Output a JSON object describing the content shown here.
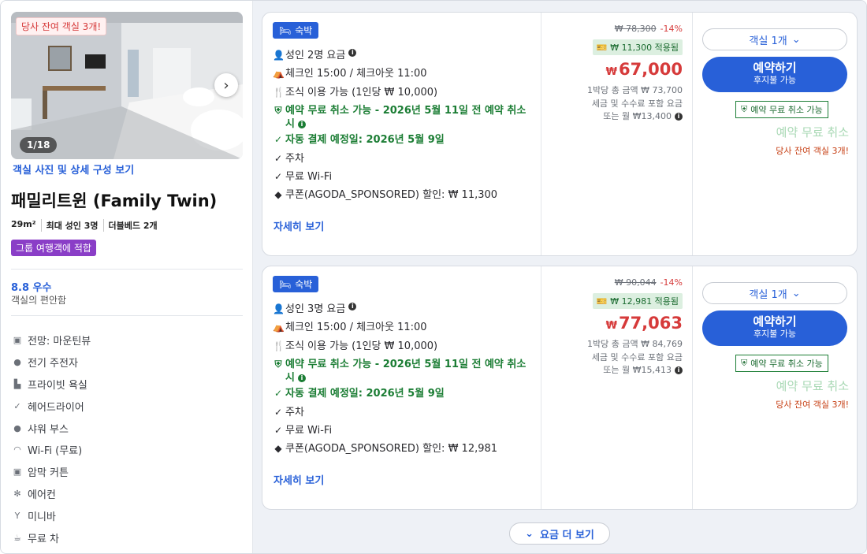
{
  "room": {
    "photo_badge": "당사 잔여 객실 3개!",
    "photo_counter": "1/18",
    "photo_link": "객실 사진 및 상세 구성 보기",
    "name": "패밀리트윈 (Family Twin)",
    "specs": [
      "29m²",
      "최대 성인 3명",
      "더블베드 2개"
    ],
    "group_badge": "그룹 여행객에 적합",
    "score": "8.8 우수",
    "score_sub": "객실의 편안함",
    "amenities": [
      {
        "icon": "mountain-view-icon",
        "label": "전망: 마운틴뷰"
      },
      {
        "icon": "ev-charger-icon",
        "label": "전기 주전자"
      },
      {
        "icon": "bathtub-icon",
        "label": "프라이빗 욕실"
      },
      {
        "icon": "check-icon",
        "label": "헤어드라이어"
      },
      {
        "icon": "shower-icon",
        "label": "샤워 부스"
      },
      {
        "icon": "wifi-icon",
        "label": "Wi-Fi (무료)"
      },
      {
        "icon": "blackout-curtain-icon",
        "label": "암막 커튼"
      },
      {
        "icon": "air-conditioner-icon",
        "label": "에어컨"
      },
      {
        "icon": "minibar-icon",
        "label": "미니바"
      },
      {
        "icon": "tea-icon",
        "label": "무료 차"
      }
    ]
  },
  "offers": [
    {
      "stay_tag": "숙박",
      "features": [
        {
          "icon": "person-icon",
          "text": "성인 2명 요금",
          "info": true,
          "green": false
        },
        {
          "icon": "checkin-icon",
          "text": "체크인 15:00 / 체크아웃 11:00",
          "info": false,
          "green": false
        },
        {
          "icon": "breakfast-icon",
          "text": "조식 이용 가능 (1인당 ₩ 10,000)",
          "info": false,
          "green": false
        },
        {
          "icon": "shield-check-icon",
          "text": "예약 무료 취소 가능 - 2026년 5월 11일 전 예약 취소 시",
          "info": true,
          "green": true
        },
        {
          "icon": "check-icon",
          "text": "자동 결제 예정일: 2026년 5월 9일",
          "info": false,
          "green": true
        },
        {
          "icon": "check-icon",
          "text": "주차",
          "info": false,
          "green": false
        },
        {
          "icon": "check-icon",
          "text": "무료 Wi-Fi",
          "info": false,
          "green": false
        },
        {
          "icon": "tag-icon",
          "text": "쿠폰(AGODA_SPONSORED) 할인: ₩ 11,300",
          "info": false,
          "green": false
        }
      ],
      "details_link": "자세히 보기",
      "original_price": "₩ 78,300",
      "discount_pct": "-14%",
      "coupon_applied": "₩ 11,300 적용됨",
      "currency": "₩",
      "price": "67,000",
      "note1": "1박당 총 금액 ₩ 73,700",
      "note2": "세금 및 수수료 포함 요금",
      "note3": "또는 월 ₩13,400",
      "room_select": "객실 1개",
      "book_main": "예약하기",
      "book_sub": "후지불 가능",
      "free_cancel_badge": "예약 무료 취소 가능",
      "free_cancel_big": "예약 무료 취소",
      "rooms_left": "당사 잔여 객실 3개!"
    },
    {
      "stay_tag": "숙박",
      "features": [
        {
          "icon": "person-icon",
          "text": "성인 3명 요금",
          "info": true,
          "green": false
        },
        {
          "icon": "checkin-icon",
          "text": "체크인 15:00 / 체크아웃 11:00",
          "info": false,
          "green": false
        },
        {
          "icon": "breakfast-icon",
          "text": "조식 이용 가능 (1인당 ₩ 10,000)",
          "info": false,
          "green": false
        },
        {
          "icon": "shield-check-icon",
          "text": "예약 무료 취소 가능 - 2026년 5월 11일 전 예약 취소 시",
          "info": true,
          "green": true
        },
        {
          "icon": "check-icon",
          "text": "자동 결제 예정일: 2026년 5월 9일",
          "info": false,
          "green": true
        },
        {
          "icon": "check-icon",
          "text": "주차",
          "info": false,
          "green": false
        },
        {
          "icon": "check-icon",
          "text": "무료 Wi-Fi",
          "info": false,
          "green": false
        },
        {
          "icon": "tag-icon",
          "text": "쿠폰(AGODA_SPONSORED) 할인: ₩ 12,981",
          "info": false,
          "green": false
        }
      ],
      "details_link": "자세히 보기",
      "original_price": "₩ 90,044",
      "discount_pct": "-14%",
      "coupon_applied": "₩ 12,981 적용됨",
      "currency": "₩",
      "price": "77,063",
      "note1": "1박당 총 금액 ₩ 84,769",
      "note2": "세금 및 수수료 포함 요금",
      "note3": "또는 월 ₩15,413",
      "room_select": "객실 1개",
      "book_main": "예약하기",
      "book_sub": "후지불 가능",
      "free_cancel_badge": "예약 무료 취소 가능",
      "free_cancel_big": "예약 무료 취소",
      "rooms_left": "당사 잔여 객실 3개!"
    }
  ],
  "more_rates": "요금 더 보기",
  "colors": {
    "accent": "#2860d8",
    "price_red": "#d63a3a",
    "green": "#1b7d34",
    "purple": "#8a3ec7"
  }
}
